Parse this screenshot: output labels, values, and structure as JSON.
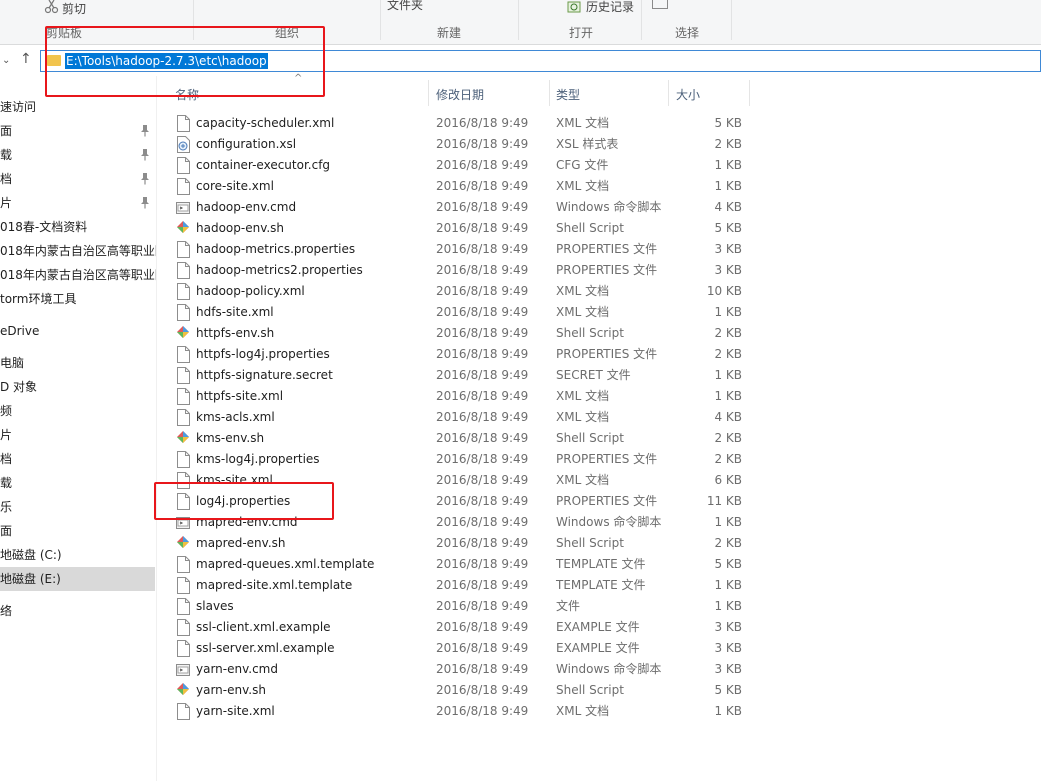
{
  "ribbon": {
    "cut": "剪切",
    "folder_text": "文件夹",
    "history": "历史记录",
    "groups": {
      "clipboard": "剪贴板",
      "organize": "组织",
      "new": "新建",
      "open": "打开",
      "select": "选择"
    }
  },
  "address": {
    "path": "E:\\Tools\\hadoop-2.7.3\\etc\\hadoop"
  },
  "sidebar": {
    "items": [
      {
        "label": "速访问",
        "pinned": false
      },
      {
        "label": "面",
        "pinned": true
      },
      {
        "label": "载",
        "pinned": true
      },
      {
        "label": "档",
        "pinned": true
      },
      {
        "label": "片",
        "pinned": true
      },
      {
        "label": "018春-文档资料",
        "pinned": false
      },
      {
        "label": "018年内蒙古自治区高等职业院",
        "pinned": false
      },
      {
        "label": "018年内蒙古自治区高等职业院",
        "pinned": false
      },
      {
        "label": "torm环境工具",
        "pinned": false
      },
      {
        "label": "eDrive",
        "pinned": false
      },
      {
        "label": "电脑",
        "pinned": false
      },
      {
        "label": "D 对象",
        "pinned": false
      },
      {
        "label": "频",
        "pinned": false
      },
      {
        "label": "片",
        "pinned": false
      },
      {
        "label": "档",
        "pinned": false
      },
      {
        "label": "载",
        "pinned": false
      },
      {
        "label": "乐",
        "pinned": false
      },
      {
        "label": "面",
        "pinned": false
      },
      {
        "label": "地磁盘 (C:)",
        "pinned": false
      },
      {
        "label": "地磁盘 (E:)",
        "pinned": false,
        "selected": true
      },
      {
        "label": "络",
        "pinned": false
      }
    ]
  },
  "columns": {
    "name": "名称",
    "date": "修改日期",
    "type": "类型",
    "size": "大小"
  },
  "files": [
    {
      "name": "capacity-scheduler.xml",
      "date": "2016/8/18 9:49",
      "type": "XML 文档",
      "size": "5 KB",
      "icon": "xml-file-icon"
    },
    {
      "name": "configuration.xsl",
      "date": "2016/8/18 9:49",
      "type": "XSL 样式表",
      "size": "2 KB",
      "icon": "xsl-file-icon"
    },
    {
      "name": "container-executor.cfg",
      "date": "2016/8/18 9:49",
      "type": "CFG 文件",
      "size": "1 KB",
      "icon": "file-icon"
    },
    {
      "name": "core-site.xml",
      "date": "2016/8/18 9:49",
      "type": "XML 文档",
      "size": "1 KB",
      "icon": "xml-file-icon"
    },
    {
      "name": "hadoop-env.cmd",
      "date": "2016/8/18 9:49",
      "type": "Windows 命令脚本",
      "size": "4 KB",
      "icon": "cmd-file-icon"
    },
    {
      "name": "hadoop-env.sh",
      "date": "2016/8/18 9:49",
      "type": "Shell Script",
      "size": "5 KB",
      "icon": "shell-file-icon"
    },
    {
      "name": "hadoop-metrics.properties",
      "date": "2016/8/18 9:49",
      "type": "PROPERTIES 文件",
      "size": "3 KB",
      "icon": "file-icon"
    },
    {
      "name": "hadoop-metrics2.properties",
      "date": "2016/8/18 9:49",
      "type": "PROPERTIES 文件",
      "size": "3 KB",
      "icon": "file-icon"
    },
    {
      "name": "hadoop-policy.xml",
      "date": "2016/8/18 9:49",
      "type": "XML 文档",
      "size": "10 KB",
      "icon": "xml-file-icon"
    },
    {
      "name": "hdfs-site.xml",
      "date": "2016/8/18 9:49",
      "type": "XML 文档",
      "size": "1 KB",
      "icon": "xml-file-icon"
    },
    {
      "name": "httpfs-env.sh",
      "date": "2016/8/18 9:49",
      "type": "Shell Script",
      "size": "2 KB",
      "icon": "shell-file-icon"
    },
    {
      "name": "httpfs-log4j.properties",
      "date": "2016/8/18 9:49",
      "type": "PROPERTIES 文件",
      "size": "2 KB",
      "icon": "file-icon"
    },
    {
      "name": "httpfs-signature.secret",
      "date": "2016/8/18 9:49",
      "type": "SECRET 文件",
      "size": "1 KB",
      "icon": "file-icon"
    },
    {
      "name": "httpfs-site.xml",
      "date": "2016/8/18 9:49",
      "type": "XML 文档",
      "size": "1 KB",
      "icon": "xml-file-icon"
    },
    {
      "name": "kms-acls.xml",
      "date": "2016/8/18 9:49",
      "type": "XML 文档",
      "size": "4 KB",
      "icon": "xml-file-icon"
    },
    {
      "name": "kms-env.sh",
      "date": "2016/8/18 9:49",
      "type": "Shell Script",
      "size": "2 KB",
      "icon": "shell-file-icon"
    },
    {
      "name": "kms-log4j.properties",
      "date": "2016/8/18 9:49",
      "type": "PROPERTIES 文件",
      "size": "2 KB",
      "icon": "file-icon"
    },
    {
      "name": "kms-site.xml",
      "date": "2016/8/18 9:49",
      "type": "XML 文档",
      "size": "6 KB",
      "icon": "xml-file-icon"
    },
    {
      "name": "log4j.properties",
      "date": "2016/8/18 9:49",
      "type": "PROPERTIES 文件",
      "size": "11 KB",
      "icon": "file-icon"
    },
    {
      "name": "mapred-env.cmd",
      "date": "2016/8/18 9:49",
      "type": "Windows 命令脚本",
      "size": "1 KB",
      "icon": "cmd-file-icon"
    },
    {
      "name": "mapred-env.sh",
      "date": "2016/8/18 9:49",
      "type": "Shell Script",
      "size": "2 KB",
      "icon": "shell-file-icon"
    },
    {
      "name": "mapred-queues.xml.template",
      "date": "2016/8/18 9:49",
      "type": "TEMPLATE 文件",
      "size": "5 KB",
      "icon": "file-icon"
    },
    {
      "name": "mapred-site.xml.template",
      "date": "2016/8/18 9:49",
      "type": "TEMPLATE 文件",
      "size": "1 KB",
      "icon": "file-icon"
    },
    {
      "name": "slaves",
      "date": "2016/8/18 9:49",
      "type": "文件",
      "size": "1 KB",
      "icon": "file-icon"
    },
    {
      "name": "ssl-client.xml.example",
      "date": "2016/8/18 9:49",
      "type": "EXAMPLE 文件",
      "size": "3 KB",
      "icon": "file-icon"
    },
    {
      "name": "ssl-server.xml.example",
      "date": "2016/8/18 9:49",
      "type": "EXAMPLE 文件",
      "size": "3 KB",
      "icon": "file-icon"
    },
    {
      "name": "yarn-env.cmd",
      "date": "2016/8/18 9:49",
      "type": "Windows 命令脚本",
      "size": "3 KB",
      "icon": "cmd-file-icon"
    },
    {
      "name": "yarn-env.sh",
      "date": "2016/8/18 9:49",
      "type": "Shell Script",
      "size": "5 KB",
      "icon": "shell-file-icon"
    },
    {
      "name": "yarn-site.xml",
      "date": "2016/8/18 9:49",
      "type": "XML 文档",
      "size": "1 KB",
      "icon": "xml-file-icon"
    }
  ],
  "colors": {
    "annotation": "#e8161b",
    "address_highlight": "#0078d7",
    "folder": "#f2c44d"
  }
}
